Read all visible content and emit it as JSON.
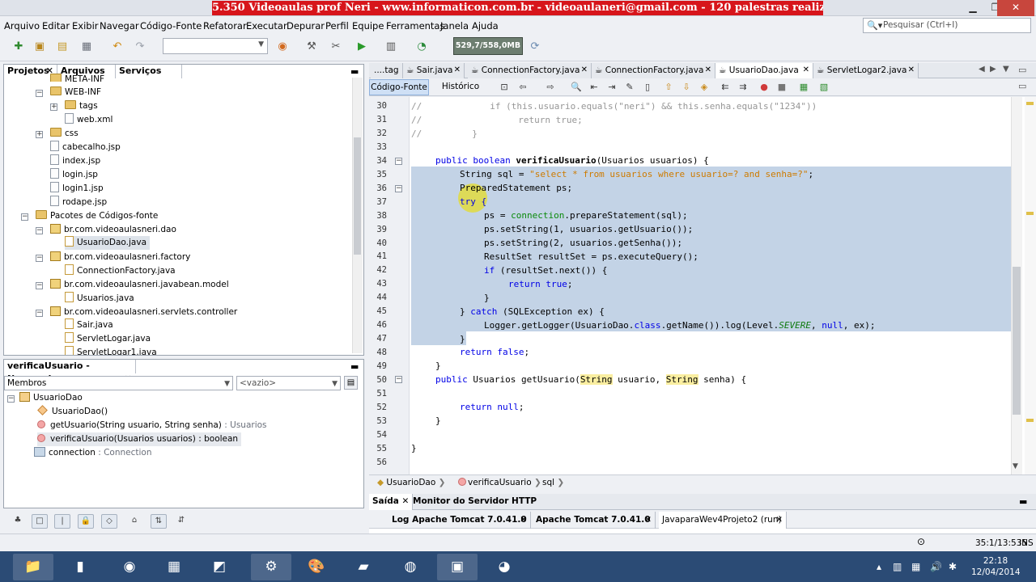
{
  "banner": "5.350 Videoaulas prof Neri - www.informaticon.com.br - videoaulaneri@gmail.com - 120 palestras realizadas em 7 paises",
  "menu": [
    "Arquivo",
    "Editar",
    "Exibir",
    "Navegar",
    "Código-Fonte",
    "Refatorar",
    "Executar",
    "Depurar",
    "Perfil",
    "Equipe",
    "Ferramentas",
    "Janela",
    "Ajuda"
  ],
  "search_placeholder": "Pesquisar (Ctrl+I)",
  "memory": "529,7/558,0MB",
  "left_tabs": [
    "Projetos",
    "Arquivos",
    "Serviços"
  ],
  "project_tree": [
    {
      "label": "META-INF",
      "icon": "folder"
    },
    {
      "label": "WEB-INF",
      "icon": "folder"
    },
    {
      "label": "tags",
      "icon": "folder"
    },
    {
      "label": "web.xml",
      "icon": "file"
    },
    {
      "label": "css",
      "icon": "folder"
    },
    {
      "label": "cabecalho.jsp",
      "icon": "file"
    },
    {
      "label": "index.jsp",
      "icon": "file"
    },
    {
      "label": "login.jsp",
      "icon": "file"
    },
    {
      "label": "login1.jsp",
      "icon": "file"
    },
    {
      "label": "rodape.jsp",
      "icon": "file"
    },
    {
      "label": "Pacotes de Códigos-fonte",
      "icon": "folder"
    },
    {
      "label": "br.com.videoaulasneri.dao",
      "icon": "package"
    },
    {
      "label": "UsuarioDao.java",
      "icon": "java"
    },
    {
      "label": "br.com.videoaulasneri.factory",
      "icon": "package"
    },
    {
      "label": "ConnectionFactory.java",
      "icon": "java"
    },
    {
      "label": "br.com.videoaulasneri.javabean.model",
      "icon": "package"
    },
    {
      "label": "Usuarios.java",
      "icon": "java"
    },
    {
      "label": "br.com.videoaulasneri.servlets.controller",
      "icon": "package"
    },
    {
      "label": "Sair.java",
      "icon": "java"
    },
    {
      "label": "ServletLogar.java",
      "icon": "java"
    },
    {
      "label": "ServletLogar1.java",
      "icon": "java"
    }
  ],
  "navigator": {
    "title": "verificaUsuario - Navegador",
    "members_label": "Membros",
    "filter_label": "<vazio>",
    "class_name": "UsuarioDao",
    "items": [
      {
        "label": "UsuarioDao()",
        "type": ""
      },
      {
        "label": "getUsuario(String usuario, String senha)",
        "type": " : Usuarios"
      },
      {
        "label": "verificaUsuario(Usuarios usuarios)",
        "type": " : boolean"
      },
      {
        "label": "connection",
        "type": " : Connection"
      }
    ]
  },
  "editor_tabs": [
    "....tag",
    "Sair.java",
    "ConnectionFactory.java",
    "ConnectionFactory.java",
    "UsuarioDao.java",
    "ServletLogar2.java"
  ],
  "editor_mode": {
    "source": "Código-Fonte",
    "history": "Histórico"
  },
  "breadcrumb": [
    "UsuarioDao",
    "verificaUsuario",
    "sql"
  ],
  "output_tabs": [
    "Saída",
    "Monitor do Servidor HTTP"
  ],
  "output_subtabs": [
    "Log Apache Tomcat 7.0.41.0",
    "Apache Tomcat 7.0.41.0",
    "JavaparaWev4Projeto2 (run)"
  ],
  "status": {
    "position": "35:1/13:535",
    "mode": "INS"
  },
  "clock": {
    "time": "22:18",
    "date": "12/04/2014"
  },
  "code_lines": {
    "l30a": "//",
    "l30b": "if (this.usuario.equals(\"neri\") && this.senha.equals(\"1234\"))",
    "l31a": "//",
    "l31b": "return true;",
    "l32a": "//",
    "l32b": "}",
    "l34a": "public boolean ",
    "l34b": "verificaUsuario",
    "l34c": "(Usuarios usuarios) {",
    "l35a": "String sql = ",
    "l35b": "\"select * from usuarios where usuario=? and senha=?\"",
    "l35c": ";",
    "l36": "PreparedStatement ps;",
    "l37": "try {",
    "l38a": "ps = ",
    "l38b": "connection",
    "l38c": ".prepareStatement(sql);",
    "l39": "ps.setString(1, usuarios.getUsuario());",
    "l40": "ps.setString(2, usuarios.getSenha());",
    "l41": "ResultSet resultSet = ps.executeQuery();",
    "l42a": "if",
    "l42b": " (resultSet.next()) {",
    "l43a": "return true",
    "l43b": ";",
    "l44": "}",
    "l45a": "} ",
    "l45b": "catch",
    "l45c": " (SQLException ex) {",
    "l46a": "Logger.getLogger(UsuarioDao.",
    "l46b": "class",
    "l46c": ".getName()).log(Level.",
    "l46d": "SEVERE",
    "l46e": ", ",
    "l46f": "null",
    "l46g": ", ex);",
    "l47": "}",
    "l48a": "return false",
    "l48b": ";",
    "l49": "}",
    "l50a": "public ",
    "l50b": "Usuarios getUsuario(",
    "l50c": "String",
    "l50d": " usuario, ",
    "l50e": "String",
    "l50f": " senha) {",
    "l52a": "return null",
    "l52b": ";",
    "l53": "}",
    "l55": "}"
  },
  "line_numbers": [
    "30",
    "31",
    "32",
    "33",
    "34",
    "35",
    "36",
    "37",
    "38",
    "39",
    "40",
    "41",
    "42",
    "43",
    "44",
    "45",
    "46",
    "47",
    "48",
    "49",
    "50",
    "51",
    "52",
    "53",
    "54",
    "55",
    "56"
  ]
}
